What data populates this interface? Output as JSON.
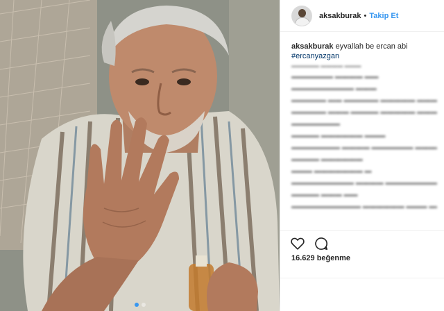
{
  "post": {
    "username": "aksakburak",
    "separator": "•",
    "follow_label": "Takip Et",
    "caption_user": "aksakburak",
    "caption_text": " eyvallah be ercan abi",
    "hashtag": "#ercanyazgan",
    "likes": "16.629 beğenme"
  },
  "icons": {
    "like": "heart-outline-icon",
    "comment": "comment-bubble-icon",
    "accent_color": "#3897f0"
  }
}
